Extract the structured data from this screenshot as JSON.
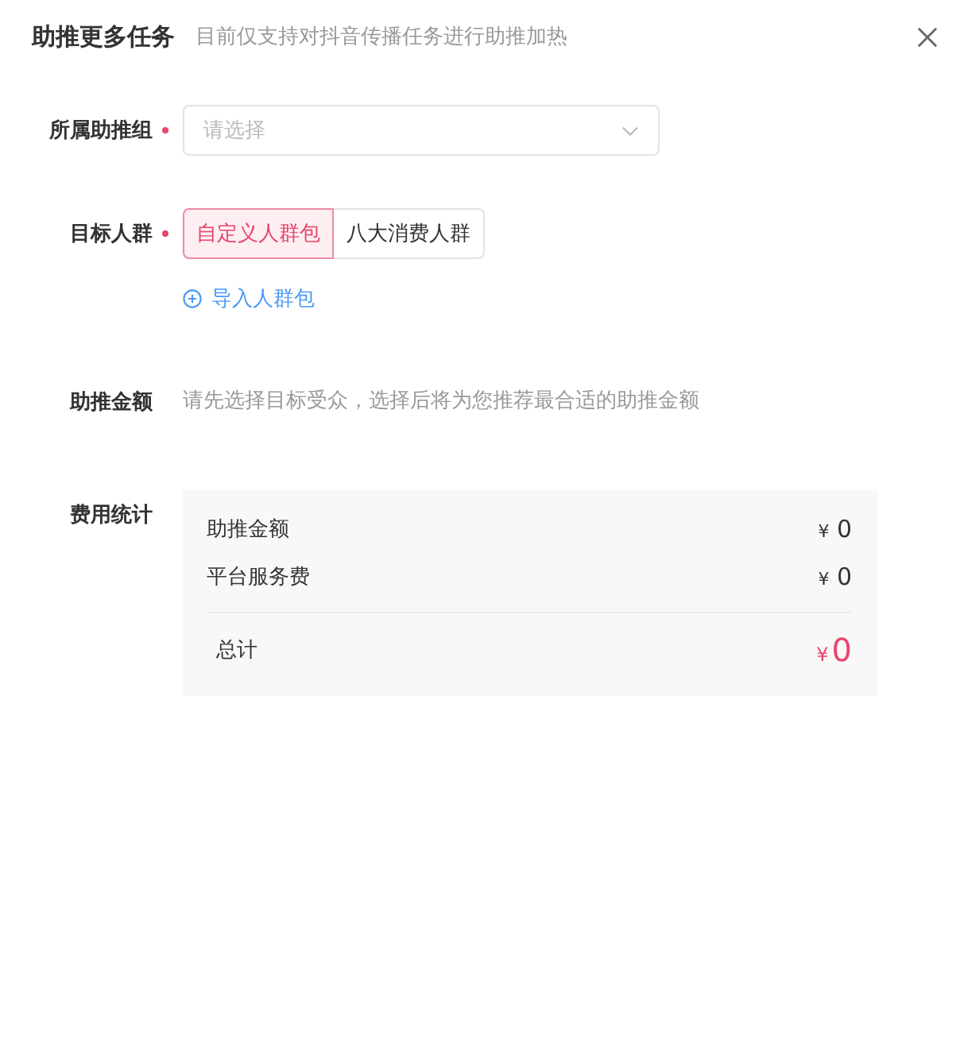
{
  "dialog": {
    "title": "助推更多任务",
    "subtitle": "目前仅支持对抖音传播任务进行助推加热"
  },
  "form": {
    "fields": [
      {
        "kind": "select",
        "label": "所属助推组",
        "required": true,
        "placeholder": "请选择"
      },
      {
        "kind": "segmented",
        "label": "目标人群",
        "required": true,
        "options": [
          {
            "label": "自定义人群包",
            "selected": true
          },
          {
            "label": "八大消费人群",
            "selected": false
          }
        ],
        "link": "导入人群包"
      },
      {
        "kind": "hint",
        "label": "助推金额",
        "required": false,
        "text": "请先选择目标受众，选择后将为您推荐最合适的助推金额"
      },
      {
        "kind": "summary",
        "label": "费用统计",
        "required": false,
        "items": [
          {
            "label": "助推金额",
            "currency": "¥",
            "amount": "0"
          },
          {
            "label": "平台服务费",
            "currency": "¥",
            "amount": "0"
          }
        ],
        "total": {
          "label": "总计",
          "currency": "¥",
          "amount": "0"
        }
      }
    ]
  }
}
